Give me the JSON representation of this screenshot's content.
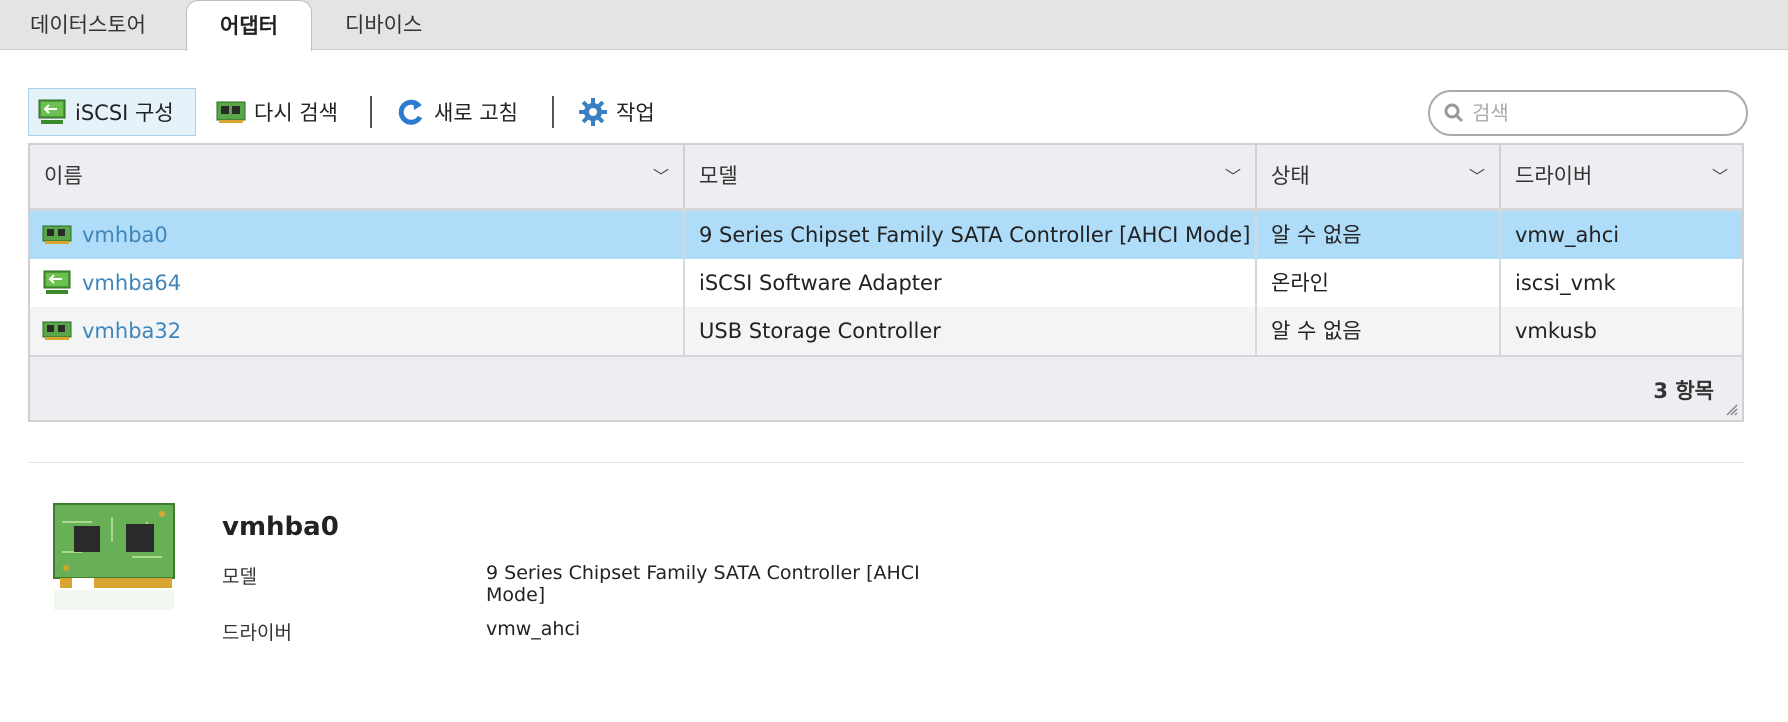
{
  "tabs": [
    {
      "label": "데이터스토어"
    },
    {
      "label": "어댑터"
    },
    {
      "label": "디바이스"
    }
  ],
  "toolbar": {
    "iscsi_config": "iSCSI 구성",
    "rescan": "다시 검색",
    "refresh": "새로 고침",
    "actions": "작업"
  },
  "search": {
    "placeholder": "검색"
  },
  "grid": {
    "columns": [
      {
        "label": "이름"
      },
      {
        "label": "모델"
      },
      {
        "label": "상태"
      },
      {
        "label": "드라이버"
      }
    ],
    "rows": [
      {
        "name": "vmhba0",
        "model": "9 Series Chipset Family SATA Controller [AHCI Mode]",
        "status": "알 수 없음",
        "driver": "vmw_ahci",
        "icon": "pci-card-icon"
      },
      {
        "name": "vmhba64",
        "model": "iSCSI Software Adapter",
        "status": "온라인",
        "driver": "iscsi_vmk",
        "icon": "iscsi-adapter-icon"
      },
      {
        "name": "vmhba32",
        "model": "USB Storage Controller",
        "status": "알 수 없음",
        "driver": "vmkusb",
        "icon": "pci-card-icon"
      }
    ],
    "count": "3 항목"
  },
  "detail": {
    "title": "vmhba0",
    "model_label": "모델",
    "model_value": "9 Series Chipset Family SATA Controller [AHCI Mode]",
    "driver_label": "드라이버",
    "driver_value": "vmw_ahci"
  },
  "colors": {
    "selected_row": "#aedcf9",
    "link": "#3f86b8",
    "header_bg": "#eceef1"
  }
}
